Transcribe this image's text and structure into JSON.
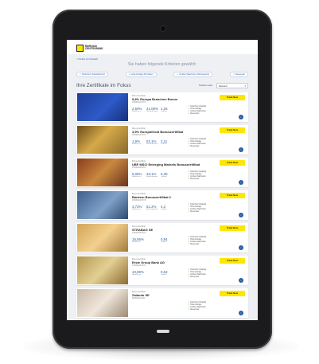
{
  "brand": {
    "line1": "Raiffeisen",
    "line2": "CENTROBANK",
    "accent": "#fee600"
  },
  "topbar": {
    "right_text": ""
  },
  "nav": {
    "back_label": "< Zurück zur Auswahl"
  },
  "heading": "Sie haben folgende Kriterien gewählt:",
  "chips": [
    "✓ Teilschutz (Kapitalschutz)",
    "✓ Hohe Erträge (Renditen)",
    "✓ Großes Wachstum (Wertpapiere)",
    "✓ Steuersatz"
  ],
  "section_title": "Ihre Zertifikate im Fokus",
  "sort": {
    "label": "Sortieren nach:",
    "value": "Relevanz"
  },
  "cards": [
    {
      "label": "Bonus-Zertifikat",
      "title": "5,8% Europa Branchen Bonus",
      "isin": "AT0000A1XXXX",
      "stats": [
        {
          "value": "2,50%",
          "label": "Rendite p.a."
        },
        {
          "value": "41,08%",
          "label": "Bonusabstand"
        },
        {
          "value": "1,26",
          "label": "Laufzeit"
        }
      ],
      "features": [
        "Teilschutz (Kapital)",
        "Hohe Erträge",
        "Großes Wachstum",
        "Steuersatz"
      ],
      "button": "Trade Now"
    },
    {
      "label": "Bonus-Zertifikat",
      "title": "3,9% Europa/Gold Bonuszertifikat",
      "isin": "AT0000A2XXXX",
      "stats": [
        {
          "value": "1,9%",
          "label": "Rendite p.a."
        },
        {
          "value": "52,1%",
          "label": "Bonusabstand"
        },
        {
          "value": "2,11",
          "label": "Laufzeit"
        }
      ],
      "features": [
        "Teilschutz (Kapital)",
        "Hohe Erträge",
        "Großes Wachstum",
        "Steuersatz"
      ],
      "button": "Trade Now"
    },
    {
      "label": "Bonus-Zertifikat",
      "title": "UBF MSCI Emerging Markets Bonuszertifikat",
      "isin": "AT0000A3XXXX",
      "stats": [
        {
          "value": "6,05%",
          "label": "Rendite p.a."
        },
        {
          "value": "33,1%",
          "label": "Bonusabstand"
        },
        {
          "value": "6,35",
          "label": "Laufzeit"
        }
      ],
      "features": [
        "Teilschutz (Kapital)",
        "Hohe Erträge",
        "Großes Wachstum",
        "Steuersatz"
      ],
      "button": "Trade Now"
    },
    {
      "label": "Bonus-Zertifikat",
      "title": "Bankem Bonuszertifikat 2",
      "isin": "AT0000A4XXXX",
      "stats": [
        {
          "value": "4,72%",
          "label": "Rendite p.a."
        },
        {
          "value": "51,2%",
          "label": "Bonusabstand"
        },
        {
          "value": "4,2",
          "label": "Laufzeit"
        }
      ],
      "features": [
        "Teilschutz (Kapital)",
        "Hohe Erträge",
        "Großes Wachstum",
        "Steuersatz"
      ],
      "button": "Trade Now"
    },
    {
      "label": "Bonus-Zertifikat",
      "title": "STRABAG SE",
      "isin": "AT0000A5XXXX",
      "stats": [
        {
          "value": "15,56%",
          "label": "Rendite p.a."
        },
        {
          "value": "",
          "label": ""
        },
        {
          "value": "0,84",
          "label": "Laufzeit"
        }
      ],
      "features": [
        "Teilschutz (Kapital)",
        "Hohe Erträge",
        "Großes Wachstum",
        "Steuersatz"
      ],
      "button": "Trade Now"
    },
    {
      "label": "Bonus-Zertifikat",
      "title": "Erste Group Bank AG",
      "isin": "AT0000A6XXXX",
      "stats": [
        {
          "value": "10,89%",
          "label": "Rendite p.a."
        },
        {
          "value": "",
          "label": ""
        },
        {
          "value": "0,62",
          "label": "Laufzeit"
        }
      ],
      "features": [
        "Teilschutz (Kapital)",
        "Hohe Erträge",
        "Großes Wachstum",
        "Steuersatz"
      ],
      "button": "Trade Now"
    },
    {
      "label": "Bonus-Zertifikat",
      "title": "Zalando SE",
      "isin": "DE000ZAL1111",
      "stats": [
        {
          "value": "",
          "label": ""
        },
        {
          "value": "",
          "label": ""
        },
        {
          "value": "",
          "label": ""
        }
      ],
      "features": [
        "Teilschutz (Kapital)",
        "Hohe Erträge",
        "Großes Wachstum",
        "Steuersatz"
      ],
      "button": "Trade Now"
    }
  ],
  "icons": {
    "info": "info-icon",
    "check": "check-icon",
    "camera": "camera-icon",
    "home": "home-button-icon"
  }
}
